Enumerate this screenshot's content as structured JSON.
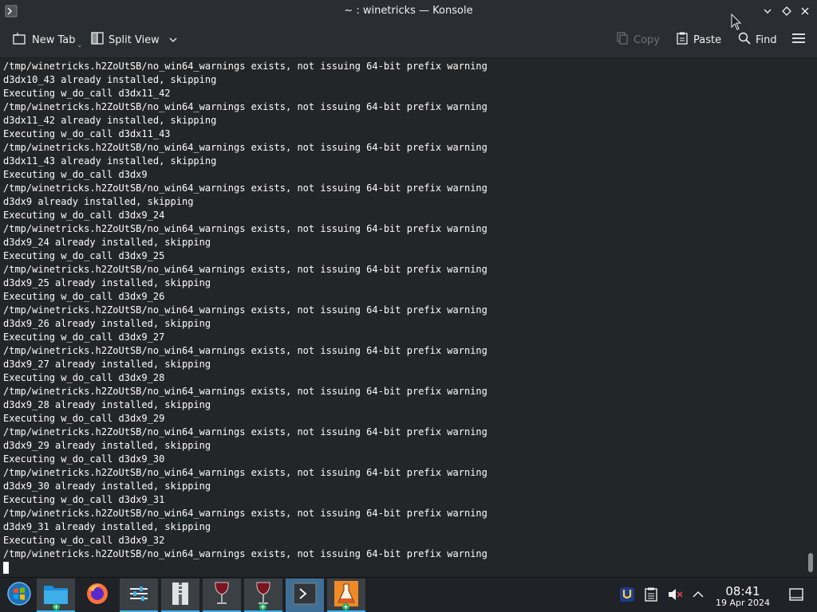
{
  "window": {
    "title": "~ : winetricks — Konsole"
  },
  "toolbar": {
    "new_tab": "New Tab",
    "split_view": "Split View",
    "copy": "Copy",
    "paste": "Paste",
    "find": "Find"
  },
  "terminal": {
    "lines": [
      "/tmp/winetricks.h2ZoUtSB/no_win64_warnings exists, not issuing 64-bit prefix warning",
      "d3dx10_43 already installed, skipping",
      "Executing w_do_call d3dx11_42",
      "/tmp/winetricks.h2ZoUtSB/no_win64_warnings exists, not issuing 64-bit prefix warning",
      "d3dx11_42 already installed, skipping",
      "Executing w_do_call d3dx11_43",
      "/tmp/winetricks.h2ZoUtSB/no_win64_warnings exists, not issuing 64-bit prefix warning",
      "d3dx11_43 already installed, skipping",
      "Executing w_do_call d3dx9",
      "/tmp/winetricks.h2ZoUtSB/no_win64_warnings exists, not issuing 64-bit prefix warning",
      "d3dx9 already installed, skipping",
      "Executing w_do_call d3dx9_24",
      "/tmp/winetricks.h2ZoUtSB/no_win64_warnings exists, not issuing 64-bit prefix warning",
      "d3dx9_24 already installed, skipping",
      "Executing w_do_call d3dx9_25",
      "/tmp/winetricks.h2ZoUtSB/no_win64_warnings exists, not issuing 64-bit prefix warning",
      "d3dx9_25 already installed, skipping",
      "Executing w_do_call d3dx9_26",
      "/tmp/winetricks.h2ZoUtSB/no_win64_warnings exists, not issuing 64-bit prefix warning",
      "d3dx9_26 already installed, skipping",
      "Executing w_do_call d3dx9_27",
      "/tmp/winetricks.h2ZoUtSB/no_win64_warnings exists, not issuing 64-bit prefix warning",
      "d3dx9_27 already installed, skipping",
      "Executing w_do_call d3dx9_28",
      "/tmp/winetricks.h2ZoUtSB/no_win64_warnings exists, not issuing 64-bit prefix warning",
      "d3dx9_28 already installed, skipping",
      "Executing w_do_call d3dx9_29",
      "/tmp/winetricks.h2ZoUtSB/no_win64_warnings exists, not issuing 64-bit prefix warning",
      "d3dx9_29 already installed, skipping",
      "Executing w_do_call d3dx9_30",
      "/tmp/winetricks.h2ZoUtSB/no_win64_warnings exists, not issuing 64-bit prefix warning",
      "d3dx9_30 already installed, skipping",
      "Executing w_do_call d3dx9_31",
      "/tmp/winetricks.h2ZoUtSB/no_win64_warnings exists, not issuing 64-bit prefix warning",
      "d3dx9_31 already installed, skipping",
      "Executing w_do_call d3dx9_32",
      "/tmp/winetricks.h2ZoUtSB/no_win64_warnings exists, not issuing 64-bit prefix warning"
    ]
  },
  "taskbar": {
    "tasks": [
      {
        "name": "start-menu-icon"
      },
      {
        "name": "dolphin-file-manager-icon"
      },
      {
        "name": "firefox-icon"
      },
      {
        "name": "system-settings-icon"
      },
      {
        "name": "archive-manager-icon"
      },
      {
        "name": "wine-icon"
      },
      {
        "name": "wine-icon"
      },
      {
        "name": "konsole-icon"
      },
      {
        "name": "lab-flask-icon"
      }
    ],
    "clock": {
      "time": "08:41",
      "date": "19 Apr 2024"
    }
  },
  "colors": {
    "accent": "#3daee9",
    "background": "#232629",
    "chrome": "#2a2e32"
  }
}
